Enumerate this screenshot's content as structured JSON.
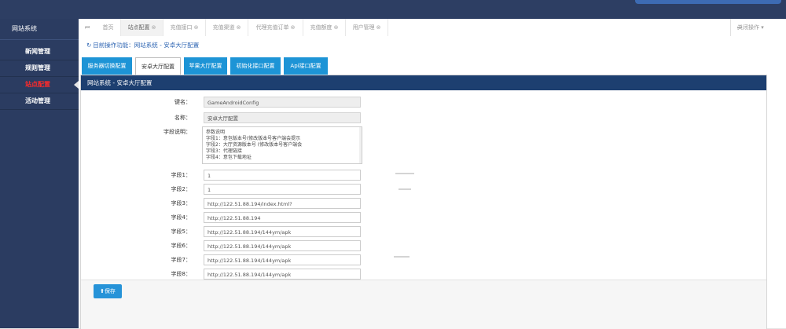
{
  "sidebar": {
    "title": "网站系统",
    "items": [
      {
        "label": "新闻管理"
      },
      {
        "label": "规则管理"
      },
      {
        "label": "站点配置"
      },
      {
        "label": "活动管理"
      }
    ]
  },
  "tabs": {
    "prev_icon": "⏮",
    "next_icon": "⏭",
    "items": [
      {
        "label": "首页"
      },
      {
        "label": "站点配置"
      },
      {
        "label": "充值接口"
      },
      {
        "label": "充值渠道"
      },
      {
        "label": "代理充值订单"
      },
      {
        "label": "充值额度"
      },
      {
        "label": "用户管理"
      }
    ],
    "close_label": "关闭操作",
    "close_icon": "▾",
    "tab_close_icon": "⊗"
  },
  "breadcrumb": {
    "icon": "↻",
    "text": "目前操作功能：网站系统 - 安卓大厅配置"
  },
  "subtabs": [
    {
      "label": "服务器切换配置"
    },
    {
      "label": "安卓大厅配置"
    },
    {
      "label": "苹果大厅配置"
    },
    {
      "label": "初始化接口配置"
    },
    {
      "label": "Api接口配置"
    }
  ],
  "panel": {
    "title": "网站系统 - 安卓大厅配置"
  },
  "form": {
    "key_label": "键名：",
    "key_value": "GameAndroidConfig",
    "name_label": "名称：",
    "name_value": "安卓大厅配置",
    "desc_label": "字段说明：",
    "desc_lines": [
      "参数说明",
      "字段1：意包版本号(修改版本号客户端会提示",
      "字段2：大厅资源版本号 (修改版本号客户端会",
      "字段3：代理链接",
      "字段4：意包下载地址"
    ],
    "fields": [
      {
        "label": "字段1：",
        "value": "1"
      },
      {
        "label": "字段2：",
        "value": "1"
      },
      {
        "label": "字段3：",
        "value": "http://122.51.88.194/index.html?"
      },
      {
        "label": "字段4：",
        "value": "http://122.51.88.194"
      },
      {
        "label": "字段5：",
        "value": "http://122.51.88.194/144ym/apk"
      },
      {
        "label": "字段6：",
        "value": "http://122.51.88.194/144ym/apk"
      },
      {
        "label": "字段7：",
        "value": "http://122.51.88.194/144ym/apk"
      },
      {
        "label": "字段8：",
        "value": "http://122.51.88.194/144ym/apk"
      }
    ]
  },
  "actions": {
    "save_icon": "⬆",
    "save_label": "保存"
  }
}
